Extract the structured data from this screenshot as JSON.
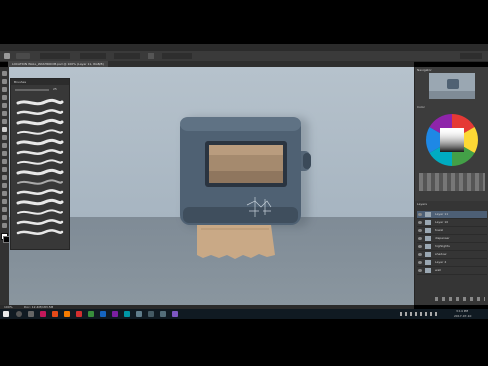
{
  "app": {
    "menu_items": [
      "File",
      "Edit",
      "Image",
      "Layer",
      "Type",
      "Select",
      "Filter",
      "3D",
      "View",
      "Window",
      "Help"
    ],
    "document_tab": "LOCATION WALL_WASHROOM.psd @ 100% (Layer 11, RGB/8)"
  },
  "brush_panel": {
    "title": "Brushes",
    "size_value": "25"
  },
  "right_panel": {
    "navigator_title": "Navigator",
    "color_title": "Color",
    "layers_title": "Layers",
    "layers": [
      {
        "name": "Layer 11"
      },
      {
        "name": "Layer 10"
      },
      {
        "name": "towel"
      },
      {
        "name": "dispenser"
      },
      {
        "name": "highlights"
      },
      {
        "name": "shadow"
      },
      {
        "name": "Layer 4"
      },
      {
        "name": "wall"
      }
    ]
  },
  "status": {
    "zoom": "100%",
    "doc": "Doc: 12.4M/183.5M"
  },
  "taskbar": {
    "time": "3:14 PM",
    "date": "2017-07-10"
  },
  "colors": {
    "dispenser_body": "#4f6173",
    "dispenser_edge": "#3b4a59",
    "paper": "#c9a986",
    "wall": "#b3c0ca",
    "floor": "#838f99"
  }
}
